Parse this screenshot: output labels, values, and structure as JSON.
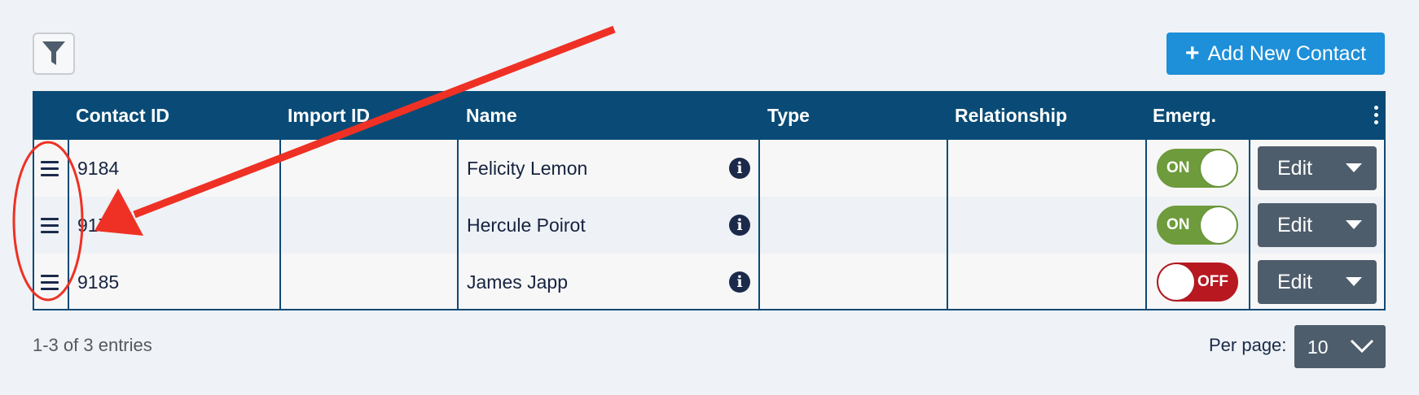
{
  "toolbar": {
    "filter_icon": "filter-icon",
    "add_button_label": "Add New Contact",
    "add_icon": "plus"
  },
  "table": {
    "columns": [
      "Contact ID",
      "Import ID",
      "Name",
      "Type",
      "Relationship",
      "Emerg."
    ],
    "rows": [
      {
        "contact_id": "9184",
        "import_id": "",
        "name": "Felicity Lemon",
        "type": "",
        "relationship": "",
        "emergency": "ON",
        "action": "Edit"
      },
      {
        "contact_id": "917",
        "import_id": "",
        "name": "Hercule Poirot",
        "type": "",
        "relationship": "",
        "emergency": "ON",
        "action": "Edit"
      },
      {
        "contact_id": "9185",
        "import_id": "",
        "name": "James Japp",
        "type": "",
        "relationship": "",
        "emergency": "OFF",
        "action": "Edit"
      }
    ]
  },
  "footer": {
    "entries_text": "1-3 of 3 entries",
    "per_page_label": "Per page:",
    "per_page_value": "10"
  },
  "colors": {
    "header_bg": "#094b76",
    "add_button": "#1e8fd9",
    "toggle_on": "#6e9b3c",
    "toggle_off": "#b81921",
    "edit_button": "#4e5d6b",
    "annotation": "#ee3124"
  }
}
